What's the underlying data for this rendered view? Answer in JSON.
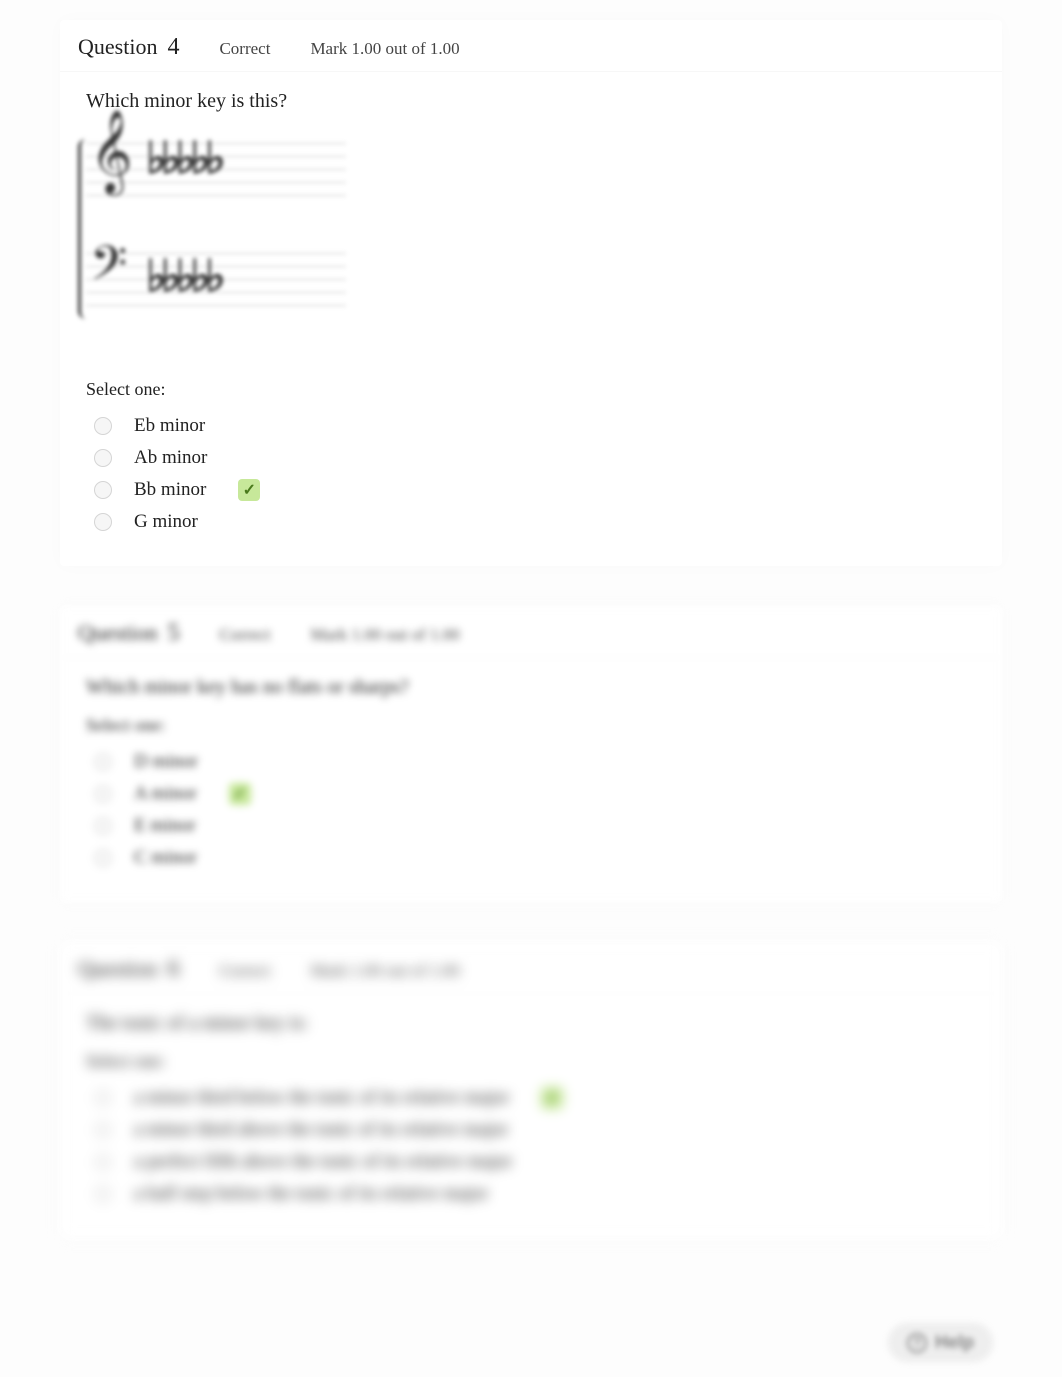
{
  "questions": [
    {
      "label": "Question",
      "number": "4",
      "status": "Correct",
      "mark": "Mark 1.00 out of 1.00",
      "text": "Which minor key is this?",
      "has_image": true,
      "select_label": "Select one:",
      "blur": "none",
      "options": [
        {
          "text": "Eb minor",
          "correct": false
        },
        {
          "text": "Ab minor",
          "correct": false
        },
        {
          "text": "Bb minor",
          "correct": true
        },
        {
          "text": "G minor",
          "correct": false
        }
      ]
    },
    {
      "label": "Question",
      "number": "5",
      "status": "Correct",
      "mark": "Mark 1.00 out of 1.00",
      "text": "Which minor key has no flats or sharps?",
      "has_image": false,
      "select_label": "Select one:",
      "blur": "mid",
      "options": [
        {
          "text": "D minor",
          "correct": false
        },
        {
          "text": "A minor",
          "correct": true
        },
        {
          "text": "E minor",
          "correct": false
        },
        {
          "text": "C minor",
          "correct": false
        }
      ]
    },
    {
      "label": "Question",
      "number": "6",
      "status": "Correct",
      "mark": "Mark 1.00 out of 1.00",
      "text": "The tonic of a minor key is:",
      "has_image": false,
      "select_label": "Select one:",
      "blur": "heavy",
      "options": [
        {
          "text": "a minor third below the tonic of its relative major",
          "correct": true
        },
        {
          "text": "a minor third above the tonic of its relative major",
          "correct": false
        },
        {
          "text": "a perfect fifth above the tonic of its relative major",
          "correct": false
        },
        {
          "text": "a half step below the tonic of its relative major",
          "correct": false
        }
      ]
    }
  ],
  "help_label": "Help",
  "tick_glyph": "✓"
}
